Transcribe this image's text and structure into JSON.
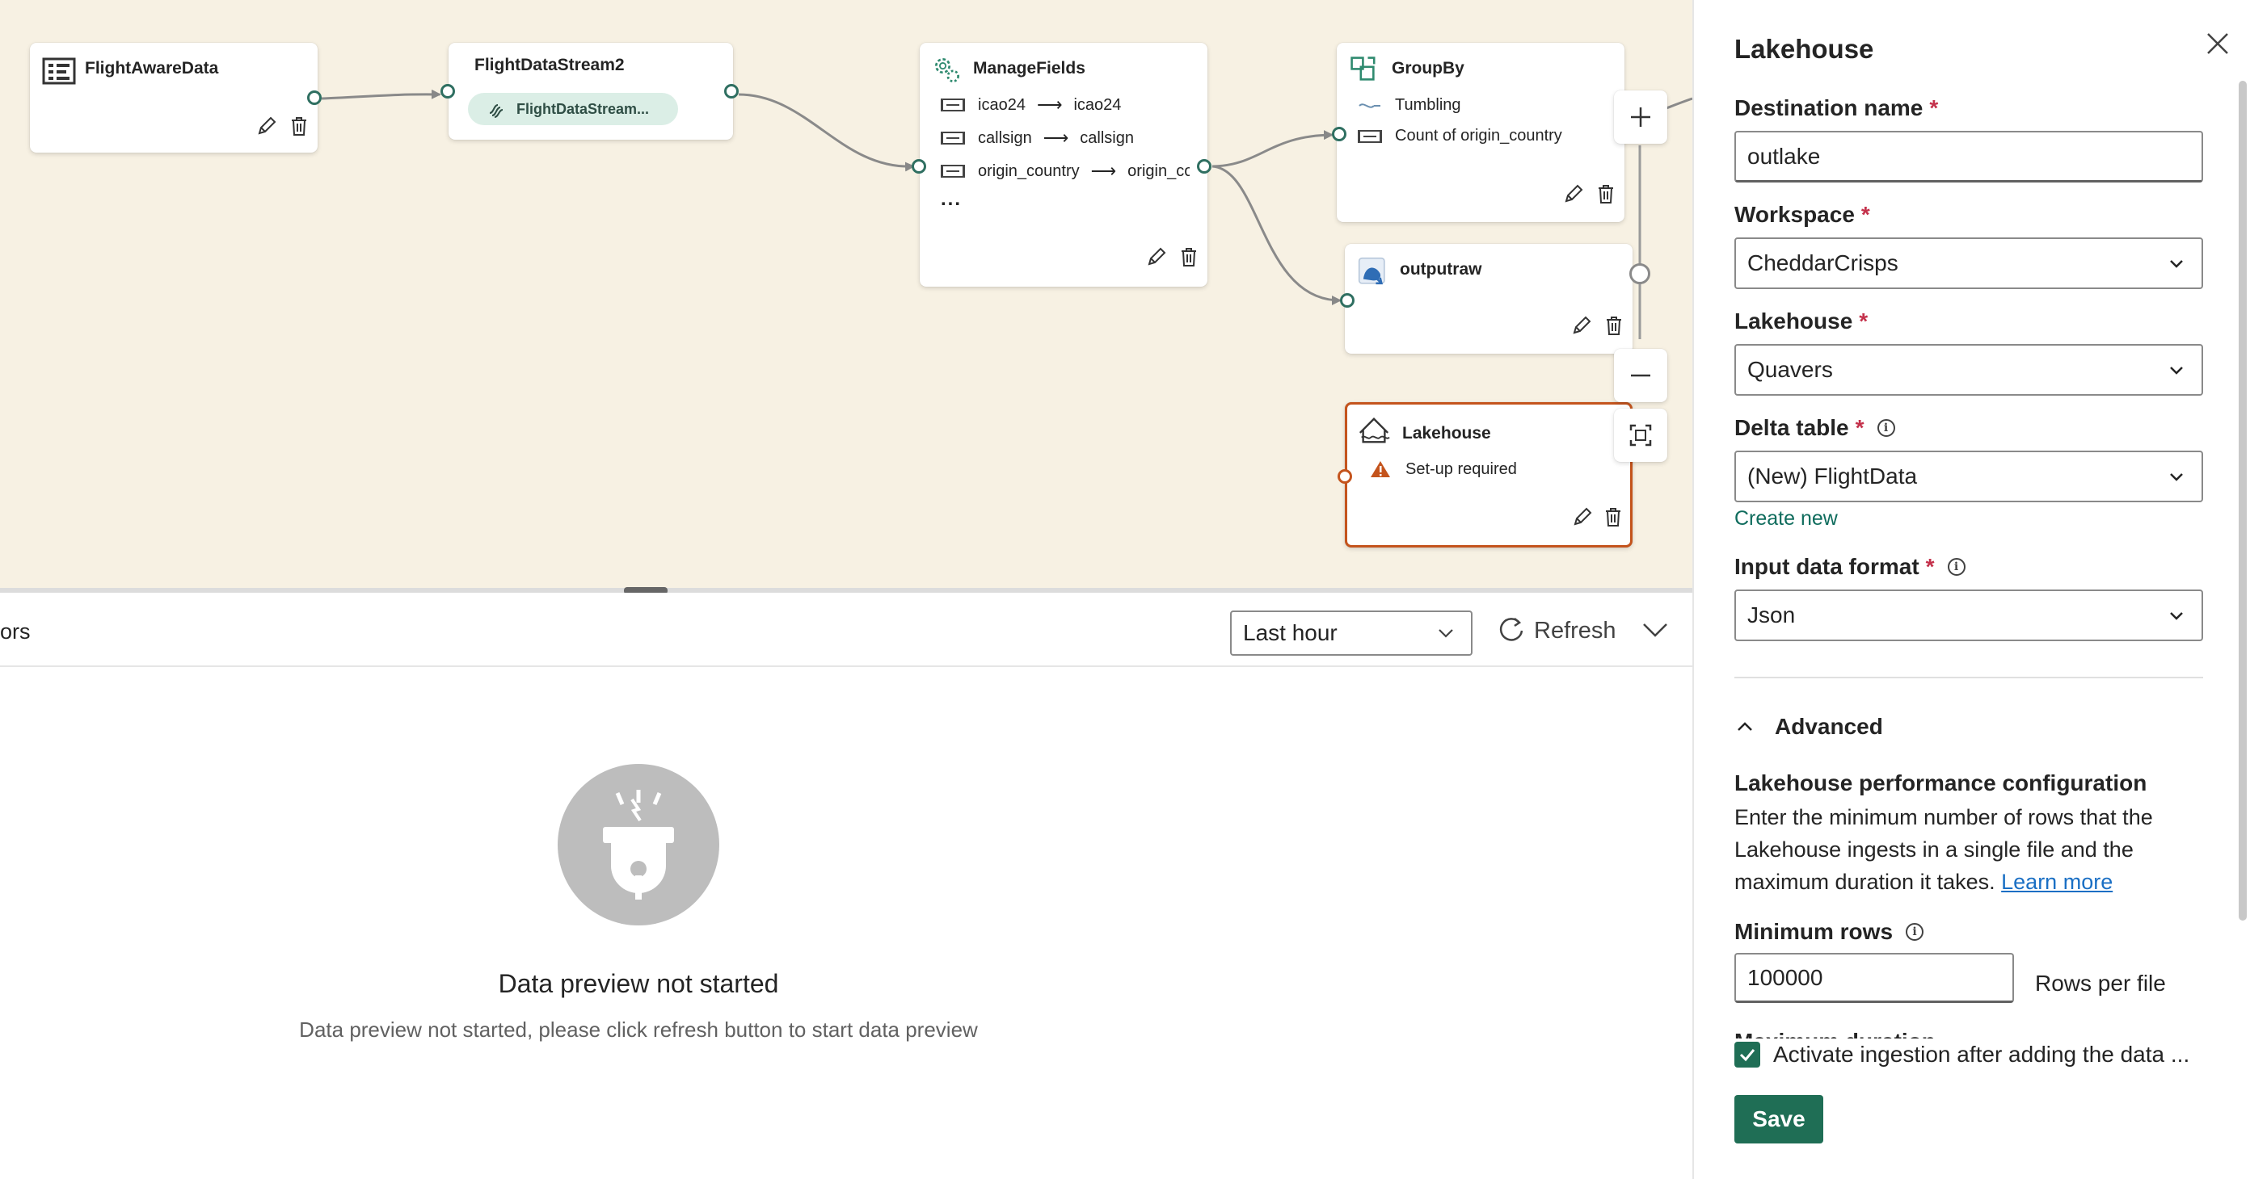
{
  "canvas": {
    "nodes": {
      "source": {
        "title": "FlightAwareData"
      },
      "stream": {
        "title": "FlightDataStream2",
        "pill": "FlightDataStream..."
      },
      "manage": {
        "title": "ManageFields",
        "rows": [
          {
            "from": "icao24",
            "to": "icao24"
          },
          {
            "from": "callsign",
            "to": "callsign"
          },
          {
            "from": "origin_country",
            "to": "origin_cou"
          }
        ],
        "more": "..."
      },
      "groupby": {
        "title": "GroupBy",
        "window": "Tumbling",
        "aggregate": "Count of origin_country"
      },
      "outputraw": {
        "title": "outputraw"
      },
      "lakehouse": {
        "title": "Lakehouse",
        "status": "Set-up required"
      }
    },
    "arrow_glyph": "⟶"
  },
  "preview": {
    "tab_fragment": "ors",
    "time_range": "Last hour",
    "refresh_label": "Refresh",
    "empty_title": "Data preview not started",
    "empty_desc": "Data preview not started, please click refresh button to start data preview"
  },
  "panel": {
    "title": "Lakehouse",
    "destination_name": {
      "label": "Destination name",
      "value": "outlake"
    },
    "workspace": {
      "label": "Workspace",
      "value": "CheddarCrisps"
    },
    "lakehouse": {
      "label": "Lakehouse",
      "value": "Quavers"
    },
    "delta_table": {
      "label": "Delta table",
      "value": "(New) FlightData",
      "create_new": "Create new"
    },
    "input_format": {
      "label": "Input data format",
      "value": "Json"
    },
    "required_mark": "*",
    "advanced": {
      "label": "Advanced",
      "perf_title": "Lakehouse performance configuration",
      "perf_desc": "Enter the minimum number of rows that the Lakehouse ingests in a single file and the maximum duration it takes.",
      "learn_more": "Learn more",
      "min_rows_label": "Minimum rows",
      "min_rows_value": "100000",
      "rows_suffix": "Rows per file",
      "max_duration_label": "Maximum duration"
    },
    "activate_label": "Activate ingestion after adding the data ...",
    "activate_checked": true,
    "save_label": "Save"
  },
  "colors": {
    "canvas_bg": "#f7f1e3",
    "accent": "#1f6e55",
    "error_border": "#c4541d",
    "required": "#c4314b",
    "link": "#1a6fc4"
  }
}
